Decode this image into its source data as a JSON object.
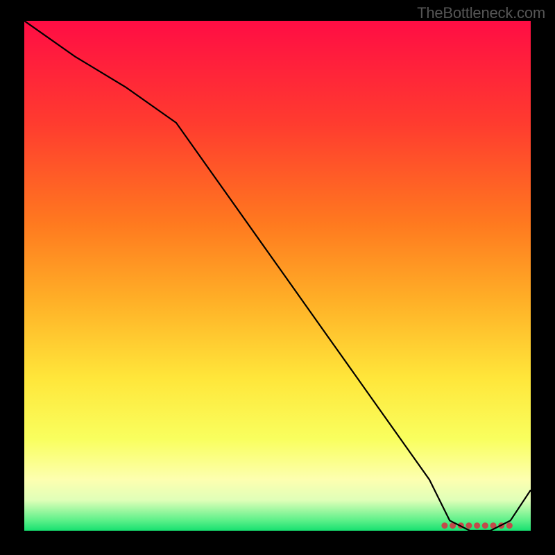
{
  "watermark": "TheBottleneck.com",
  "chart_data": {
    "type": "line",
    "title": "",
    "xlabel": "",
    "ylabel": "",
    "x": [
      0,
      10,
      20,
      30,
      40,
      50,
      60,
      70,
      80,
      84,
      88,
      92,
      96,
      100
    ],
    "values": [
      100,
      93,
      87,
      80,
      66,
      52,
      38,
      24,
      10,
      2,
      0,
      0,
      2,
      8
    ],
    "xlim": [
      0,
      100
    ],
    "ylim": [
      0,
      100
    ],
    "marker_segment": {
      "start_x": 83,
      "end_x": 96,
      "y": 1
    },
    "gradient_stops": [
      {
        "o": 0,
        "c": "#ff0d44"
      },
      {
        "o": 20,
        "c": "#ff3b2f"
      },
      {
        "o": 40,
        "c": "#ff7a1f"
      },
      {
        "o": 55,
        "c": "#ffb027"
      },
      {
        "o": 70,
        "c": "#ffe63a"
      },
      {
        "o": 82,
        "c": "#f9ff5e"
      },
      {
        "o": 90,
        "c": "#fdffb0"
      },
      {
        "o": 94,
        "c": "#e0ffb8"
      },
      {
        "o": 98,
        "c": "#5cf089"
      },
      {
        "o": 100,
        "c": "#17e070"
      }
    ],
    "line_color": "#000000",
    "marker_color": "#c24a4a"
  }
}
